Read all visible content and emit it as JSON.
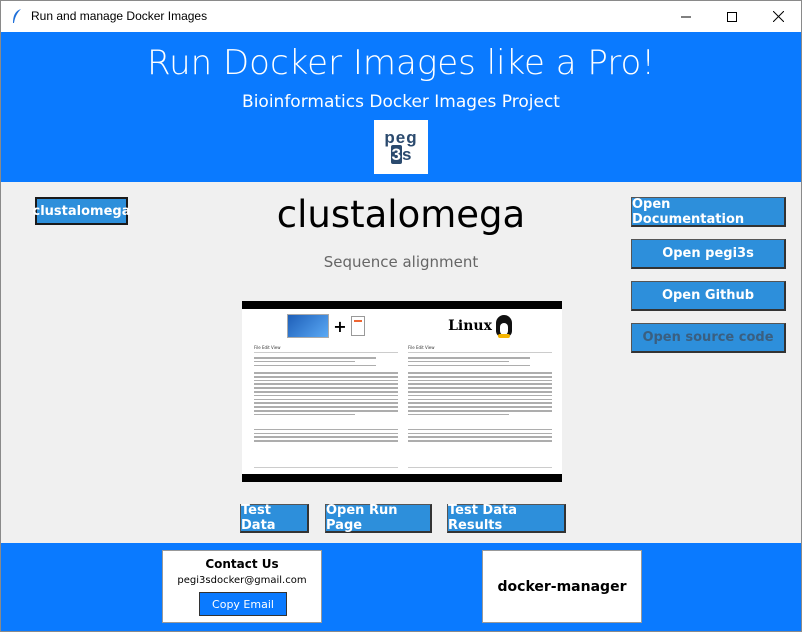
{
  "window": {
    "title": "Run and manage Docker Images",
    "icon": "feather-icon",
    "controls": [
      "minimize-icon",
      "maximize-icon",
      "close-icon"
    ]
  },
  "header": {
    "title": "Run Docker Images like a Pro!",
    "subtitle": "Bioinformatics Docker Images Project",
    "logo": {
      "top": "peg",
      "bottom_prefix": "3",
      "bottom_suffix": "s"
    }
  },
  "tool": {
    "button_label": "clustalomega",
    "name": "clustalomega",
    "description": "Sequence alignment"
  },
  "side_buttons": {
    "documentation": "Open Documentation",
    "pegi3s": "Open pegi3s",
    "github": "Open Github",
    "source_code": "Open source code"
  },
  "preview": {
    "left_menu": "File   Edit   View",
    "right_menu": "File   Edit   View",
    "right_title": "Linux"
  },
  "actions": {
    "test_data": "Test Data",
    "run_page": "Open Run Page",
    "test_results": "Test Data Results"
  },
  "footer": {
    "contact_title": "Contact Us",
    "contact_email": "pegi3sdocker@gmail.com",
    "copy_email": "Copy Email",
    "manager": "docker-manager"
  },
  "colors": {
    "header_bg": "#0a7aff",
    "button_bg": "#2d8fdb",
    "disabled_text": "#3a5f80"
  }
}
